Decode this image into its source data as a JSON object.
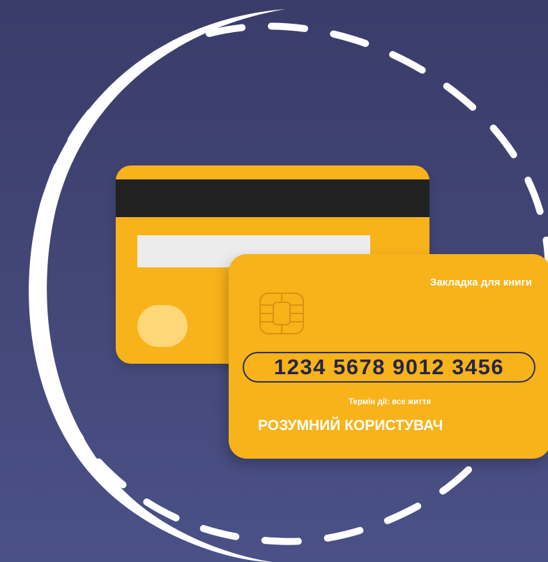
{
  "card": {
    "label": "Закладка для книги",
    "number": "1234 5678 9012 3456",
    "expiry": "Термін дії: все життя",
    "holder": "РОЗУМНИЙ КОРИСТУВАЧ"
  },
  "colors": {
    "background": "#3f4272",
    "card": "#f8b21a",
    "stripe": "#212121",
    "number_text": "#23264a",
    "ring": "#ffffff"
  },
  "icons": {
    "chip": "sim-chip-icon",
    "ring": "dashed-circle-decoration"
  }
}
